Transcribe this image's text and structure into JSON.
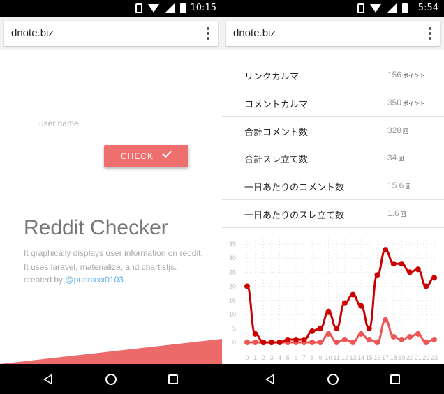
{
  "left": {
    "status_time": "10:15",
    "url": "dnote.biz",
    "username_placeholder": "user name",
    "check_label": "CHECK",
    "app_title": "Reddit Checker",
    "description_1": "It graphically displays user information on reddit.",
    "description_2": "It uses laravel, materialize, and chartistjs.",
    "created_by": "created by",
    "author": "@purinxxx0103"
  },
  "right": {
    "status_time": "5:54",
    "url": "dnote.biz",
    "stats": [
      {
        "label": "リンクカルマ",
        "value": "156",
        "unit": "ポイント"
      },
      {
        "label": "コメントカルマ",
        "value": "350",
        "unit": "ポイント"
      },
      {
        "label": "合計コメント数",
        "value": "328",
        "unit": "回"
      },
      {
        "label": "合計スレ立て数",
        "value": "34",
        "unit": "回"
      },
      {
        "label": "一日あたりのコメント数",
        "value": "15.6",
        "unit": "回"
      },
      {
        "label": "一日あたりのスレ立て数",
        "value": "1.6",
        "unit": "回"
      }
    ]
  },
  "chart_data": {
    "type": "line",
    "x": [
      "0",
      "1",
      "2",
      "3",
      "4",
      "5",
      "6",
      "7",
      "8",
      "9",
      "10",
      "11",
      "12",
      "13",
      "14",
      "15",
      "16",
      "17",
      "18",
      "19",
      "20",
      "21",
      "22",
      "23"
    ],
    "y_ticks": [
      "0",
      "5",
      "10",
      "15",
      "20",
      "25",
      "30",
      "35"
    ],
    "ylim": [
      0,
      36
    ],
    "series": [
      {
        "color": "#cc0000",
        "values": [
          20,
          3,
          0,
          0,
          0,
          1,
          1,
          1,
          4,
          5,
          11,
          5,
          14,
          17,
          13,
          5,
          24,
          33,
          28,
          28,
          25,
          26,
          20,
          23
        ]
      },
      {
        "color": "#ee5555",
        "values": [
          0,
          0,
          0,
          0,
          0,
          0,
          0,
          0,
          0,
          0,
          3,
          0,
          1,
          0,
          3,
          1,
          0,
          8,
          2,
          1,
          2,
          3,
          0,
          1
        ]
      }
    ],
    "grid": true
  }
}
